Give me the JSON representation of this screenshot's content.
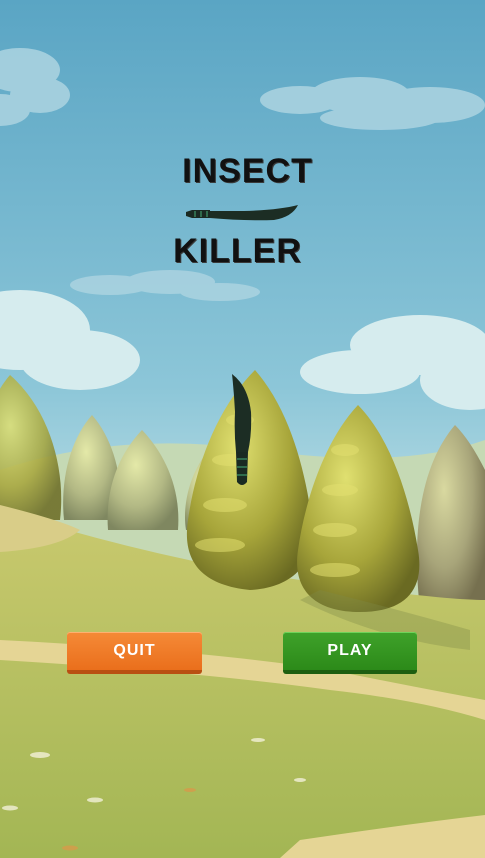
{
  "game": {
    "title_line1": "INSECT",
    "title_line2": "KILLER"
  },
  "buttons": {
    "quit_label": "QUIT",
    "play_label": "PLAY"
  },
  "colors": {
    "sky_top": "#5fa8c6",
    "sky_bottom": "#c8e6ea",
    "grass": "#b6bf5e",
    "path": "#e3d28e",
    "quit_button": "#f07c27",
    "play_button": "#349620",
    "title_text": "#111111"
  },
  "icons": {
    "title_knife": "machete-icon",
    "center_knife": "machete-icon"
  }
}
